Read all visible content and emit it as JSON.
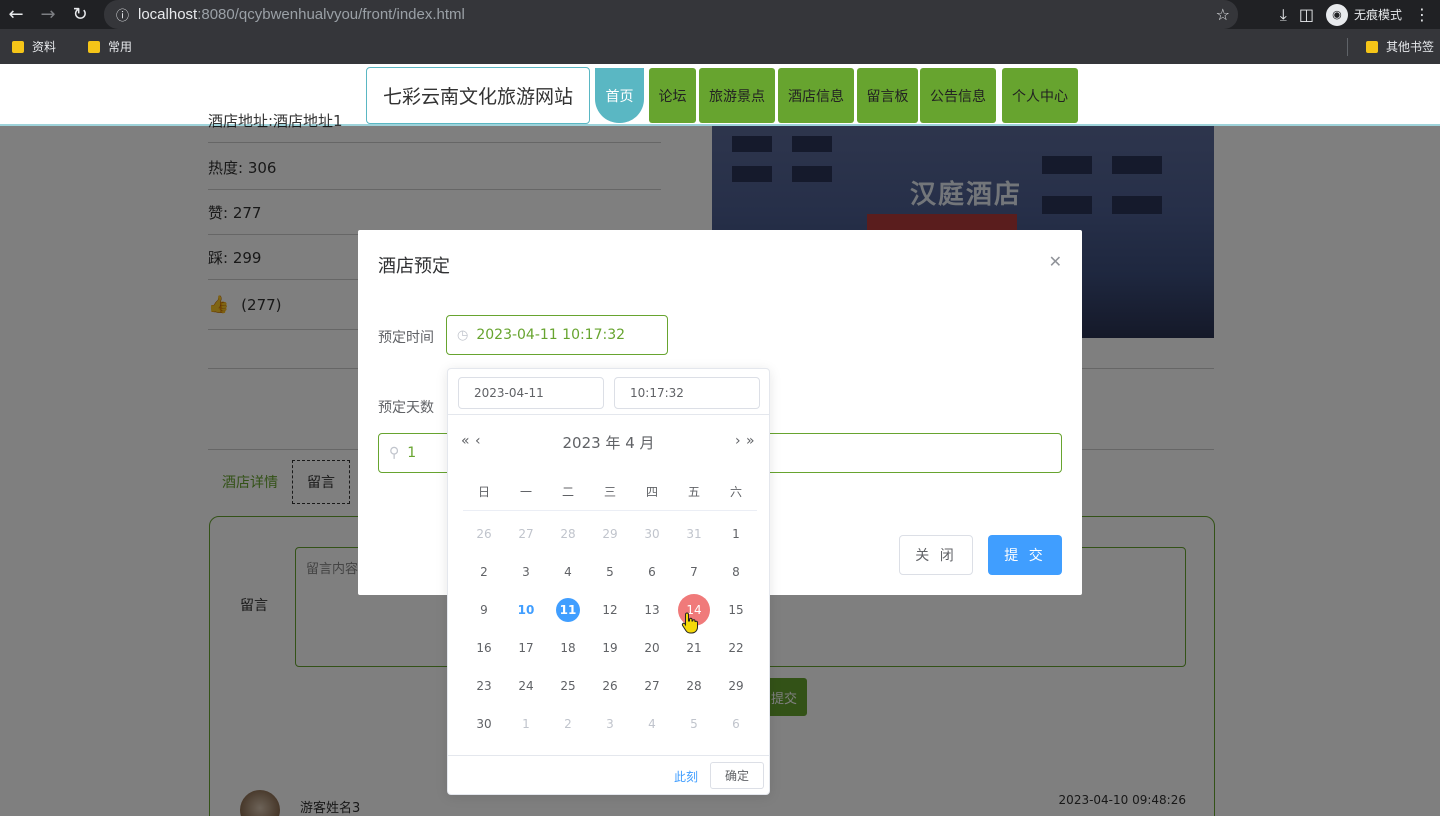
{
  "browser": {
    "url_host": "localhost",
    "url_path": ":8080/qcybwenhualvyou/front/index.html",
    "incognito_label": "无痕模式",
    "bookmarks": [
      "资料",
      "常用"
    ],
    "other_bookmarks": "其他书签"
  },
  "site": {
    "title": "七彩云南文化旅游网站",
    "nav": [
      "首页",
      "论坛",
      "旅游景点",
      "酒店信息",
      "留言板",
      "公告信息",
      "个人中心"
    ]
  },
  "hotel": {
    "address_cut": "酒店地址:酒店地址1",
    "heat": "热度: 306",
    "likes": "赞: 277",
    "dislikes": "踩: 299",
    "thumb_count": "(277)",
    "image_sign": "汉庭酒店"
  },
  "tabs": [
    "酒店详情",
    "留言"
  ],
  "message": {
    "label": "留言",
    "placeholder": "留言内容",
    "submit": "提交",
    "commenter": "游客姓名3",
    "time": "2023-04-10 09:48:26"
  },
  "dialog": {
    "title": "酒店预定",
    "time_label": "预定时间",
    "time_value": "2023-04-11 10:17:32",
    "days_label": "预定天数",
    "days_value": "1",
    "close_btn": "关 闭",
    "submit_btn": "提 交"
  },
  "picker": {
    "date_field": "2023-04-11",
    "time_field": "10:17:32",
    "year_month": "2023 年  4 月",
    "weekdays": [
      "日",
      "一",
      "二",
      "三",
      "四",
      "五",
      "六"
    ],
    "weeks": [
      [
        "26",
        "27",
        "28",
        "29",
        "30",
        "31",
        "1"
      ],
      [
        "2",
        "3",
        "4",
        "5",
        "6",
        "7",
        "8"
      ],
      [
        "9",
        "10",
        "11",
        "12",
        "13",
        "14",
        "15"
      ],
      [
        "16",
        "17",
        "18",
        "19",
        "20",
        "21",
        "22"
      ],
      [
        "23",
        "24",
        "25",
        "26",
        "27",
        "28",
        "29"
      ],
      [
        "30",
        "1",
        "2",
        "3",
        "4",
        "5",
        "6"
      ]
    ],
    "now_link": "此刻",
    "ok_btn": "确定"
  },
  "colors": {
    "accent_green": "#67a42f",
    "teal": "#5ab7c3",
    "primary_blue": "#409eff",
    "click_highlight": "#f07a7a"
  }
}
